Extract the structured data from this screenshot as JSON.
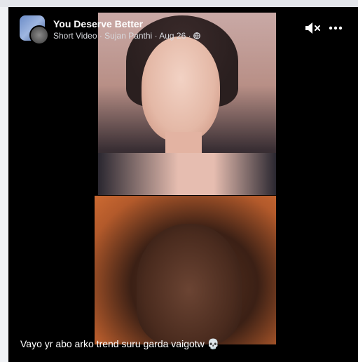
{
  "post": {
    "page_name": "You Deserve Better",
    "type_label": "Short Video",
    "author": "Sujan Panthi",
    "date": "Aug 26",
    "separator": " · ",
    "caption": "Vayo yr abo arko trend suru garda vaigotw 💀"
  },
  "icons": {
    "mute": "speaker-muted-icon",
    "more": "more-options-icon",
    "audience": "globe-icon"
  },
  "colors": {
    "card_background": "#000000",
    "text_primary": "#ffffff",
    "text_secondary": "#d8dadf"
  }
}
